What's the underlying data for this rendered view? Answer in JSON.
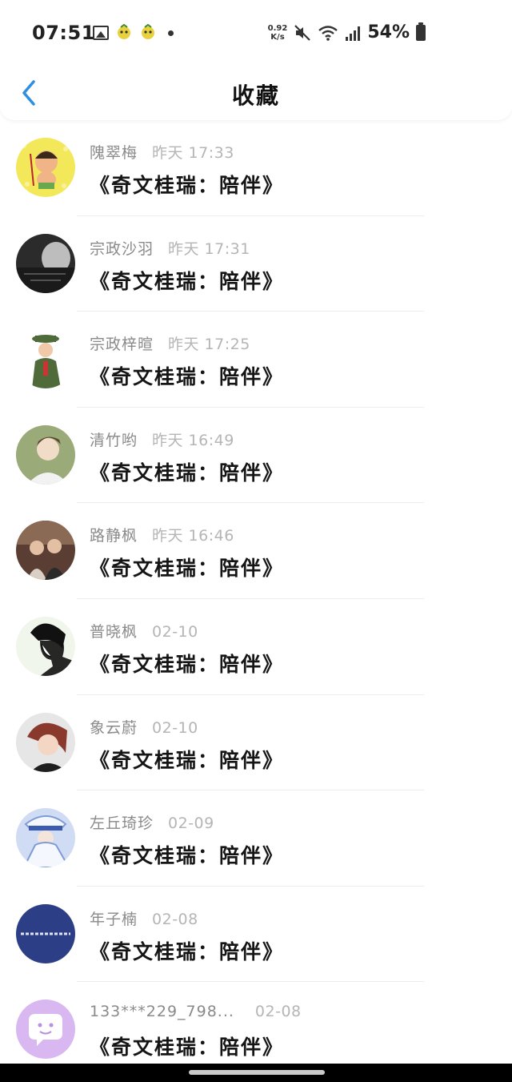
{
  "status_bar": {
    "time": "07:51",
    "net_speed_value": "0.92",
    "net_speed_unit": "K/s",
    "battery": "54%"
  },
  "header": {
    "title": "收藏"
  },
  "favorites": [
    {
      "name": "隗翠梅",
      "time": "昨天 17:33",
      "title": "《奇文桂瑞：陪伴》",
      "avatar_color": "#f3e85a"
    },
    {
      "name": "宗政沙羽",
      "time": "昨天 17:31",
      "title": "《奇文桂瑞：陪伴》",
      "avatar_color": "#2b2b2b"
    },
    {
      "name": "宗政梓暄",
      "time": "昨天 17:25",
      "title": "《奇文桂瑞：陪伴》",
      "avatar_color": "#4f6b3a"
    },
    {
      "name": "清竹哟",
      "time": "昨天 16:49",
      "title": "《奇文桂瑞：陪伴》",
      "avatar_color": "#9aaa78"
    },
    {
      "name": "路静枫",
      "time": "昨天 16:46",
      "title": "《奇文桂瑞：陪伴》",
      "avatar_color": "#5a3e33"
    },
    {
      "name": "普晓枫",
      "time": "02-10",
      "title": "《奇文桂瑞：陪伴》",
      "avatar_color": "#f1f6ec"
    },
    {
      "name": "象云蔚",
      "time": "02-10",
      "title": "《奇文桂瑞：陪伴》",
      "avatar_color": "#8a3a2c"
    },
    {
      "name": "左丘琦珍",
      "time": "02-09",
      "title": "《奇文桂瑞：陪伴》",
      "avatar_color": "#7f9bd6"
    },
    {
      "name": "年子楠",
      "time": "02-08",
      "title": "《奇文桂瑞：陪伴》",
      "avatar_color": "#2c3e86"
    },
    {
      "name": "133***229_798...",
      "time": "02-08",
      "title": "《奇文桂瑞：陪伴》",
      "avatar_color": "#d9b8f2"
    }
  ]
}
